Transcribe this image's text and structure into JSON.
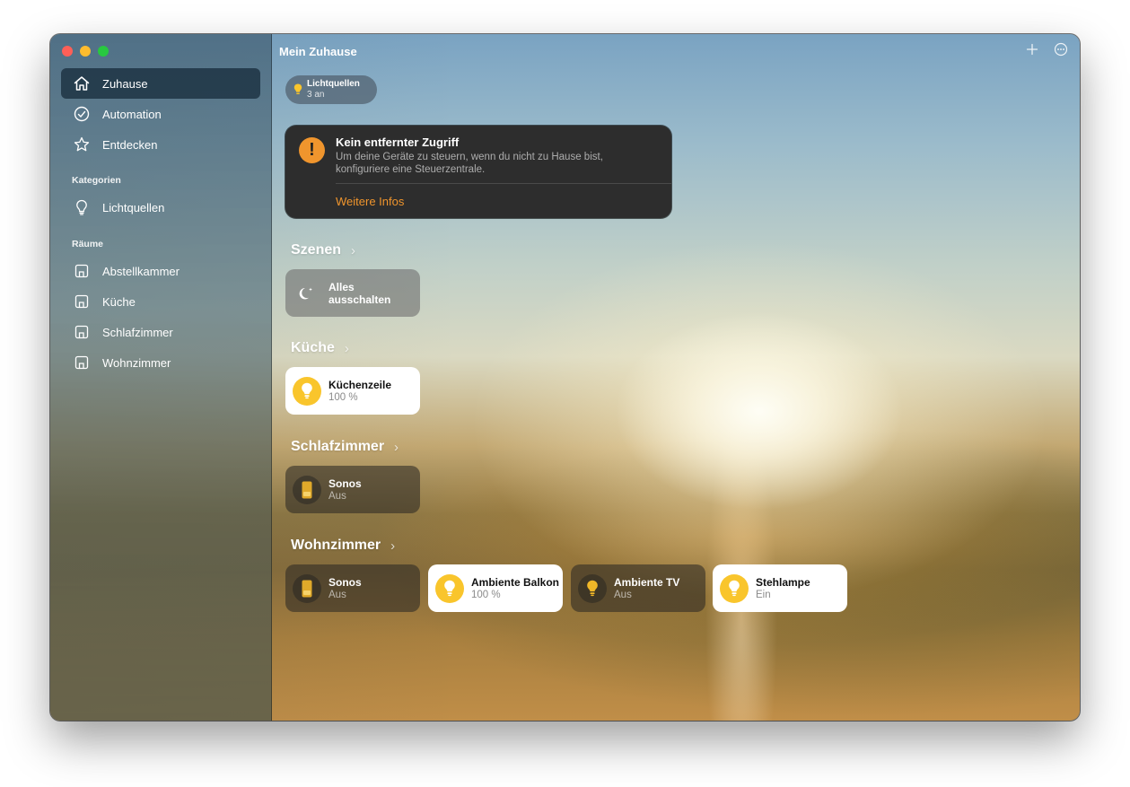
{
  "window": {
    "title": "Mein Zuhause"
  },
  "sidebar": {
    "nav": [
      {
        "label": "Zuhause",
        "icon": "home-icon",
        "active": true
      },
      {
        "label": "Automation",
        "icon": "clock-icon"
      },
      {
        "label": "Entdecken",
        "icon": "star-icon"
      }
    ],
    "categories_label": "Kategorien",
    "categories": [
      {
        "label": "Lichtquellen",
        "icon": "lightbulb-icon"
      }
    ],
    "rooms_label": "Räume",
    "rooms": [
      {
        "label": "Abstellkammer",
        "icon": "room-icon"
      },
      {
        "label": "Küche",
        "icon": "room-icon"
      },
      {
        "label": "Schlafzimmer",
        "icon": "room-icon"
      },
      {
        "label": "Wohnzimmer",
        "icon": "room-icon"
      }
    ]
  },
  "status_pill": {
    "title": "Lichtquellen",
    "subtitle": "3 an",
    "icon": "lightbulb-icon"
  },
  "alert": {
    "title": "Kein entfernter Zugriff",
    "body": "Um deine Geräte zu steuern, wenn du nicht zu Hause bist, konfiguriere eine Steuerzentrale.",
    "link": "Weitere Infos",
    "icon": "warning-icon"
  },
  "sections": {
    "scenes": {
      "title": "Szenen",
      "chevron": "›"
    },
    "kitchen": {
      "title": "Küche",
      "chevron": "›"
    },
    "bedroom": {
      "title": "Schlafzimmer",
      "chevron": "›"
    },
    "living": {
      "title": "Wohnzimmer",
      "chevron": "›"
    }
  },
  "tiles": {
    "scene_off": {
      "label": "Alles ausschalten",
      "icon": "moon-icon"
    },
    "kuechenzeile": {
      "label": "Küchenzeile",
      "status": "100 %",
      "icon": "lightbulb-icon",
      "on": true
    },
    "sonos_bedroom": {
      "label": "Sonos",
      "status": "Aus",
      "icon": "speaker-icon",
      "on": false
    },
    "sonos_living": {
      "label": "Sonos",
      "status": "Aus",
      "icon": "speaker-icon",
      "on": false
    },
    "ambiente_balkon": {
      "label": "Ambiente Balkon",
      "status": "100 %",
      "icon": "lightbulb-icon",
      "on": true
    },
    "ambiente_tv": {
      "label": "Ambiente TV",
      "status": "Aus",
      "icon": "lightbulb-icon",
      "on": false
    },
    "stehlampe": {
      "label": "Stehlampe",
      "status": "Ein",
      "icon": "lightbulb-icon",
      "on": true
    }
  },
  "colors": {
    "accent_orange": "#f0952d",
    "bulb_yellow": "#f9c52c"
  }
}
